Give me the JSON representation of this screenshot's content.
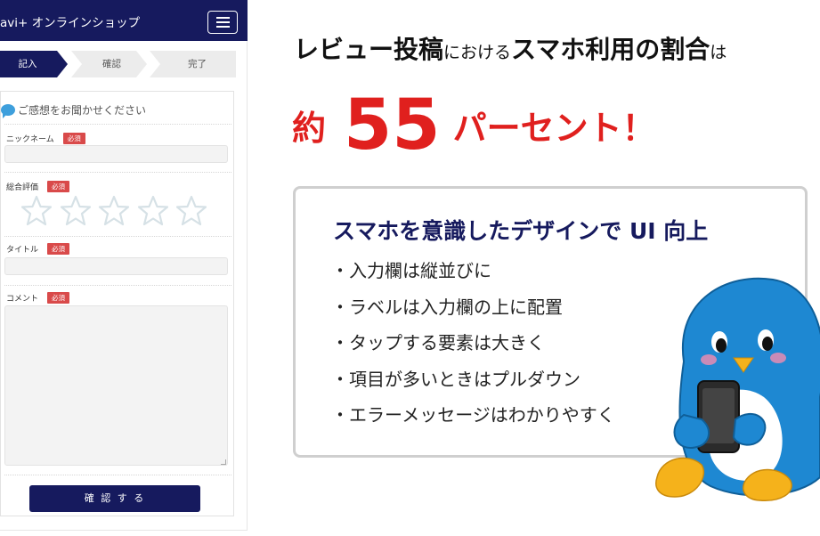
{
  "header": {
    "site_title": "avi+ オンラインショップ"
  },
  "steps": [
    "記入",
    "確認",
    "完了"
  ],
  "form": {
    "heading": "ご感想をお聞かせください",
    "required_badge": "必須",
    "fields": [
      {
        "label": "ニックネーム",
        "value": ""
      },
      {
        "label": "総合評価"
      },
      {
        "label": "タイトル",
        "value": ""
      },
      {
        "label": "コメント",
        "value": ""
      }
    ],
    "rating": {
      "stars": 5,
      "filled": 0,
      "color": "#d6e1e6"
    },
    "submit_label": "確 認 す る"
  },
  "headline": {
    "part1": "レビュー投稿",
    "part2": "における",
    "part3": "スマホ利用の割合",
    "part4": "は"
  },
  "stat": {
    "prefix": "約",
    "value": "55",
    "suffix": "パーセント！"
  },
  "tips": {
    "title": "スマホを意識したデザインで UI 向上",
    "items": [
      "・入力欄は縦並びに",
      "・ラベルは入力欄の上に配置",
      "・タップする要素は大きく",
      "・項目が多いときはプルダウン",
      "・エラーメッセージはわかりやすく"
    ]
  },
  "colors": {
    "navy": "#161a5e",
    "accent_red": "#e0201e",
    "badge_red": "#d94a4a",
    "mascot_blue": "#1e88d2"
  }
}
